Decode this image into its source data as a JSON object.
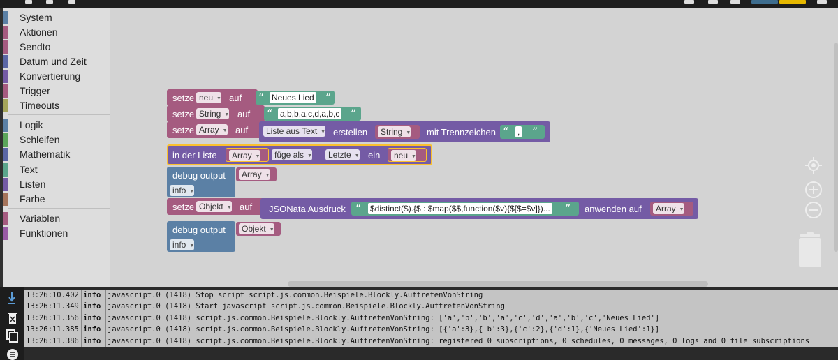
{
  "toolbox": {
    "items": [
      {
        "label": "System",
        "color": "#5b80a5"
      },
      {
        "label": "Aktionen",
        "color": "#a55b80"
      },
      {
        "label": "Sendto",
        "color": "#a55b80"
      },
      {
        "label": "Datum und Zeit",
        "color": "#5b67a5"
      },
      {
        "label": "Konvertierung",
        "color": "#745ba5"
      },
      {
        "label": "Trigger",
        "color": "#a55b80"
      },
      {
        "label": "Timeouts",
        "color": "#a5a55b"
      },
      {
        "label": "Logik",
        "color": "#5b80a5"
      },
      {
        "label": "Schleifen",
        "color": "#5ba55b"
      },
      {
        "label": "Mathematik",
        "color": "#5b67a5"
      },
      {
        "label": "Text",
        "color": "#5ba58c"
      },
      {
        "label": "Listen",
        "color": "#745ba5"
      },
      {
        "label": "Farbe",
        "color": "#a5745b"
      },
      {
        "label": "Variablen",
        "color": "#a55b80"
      },
      {
        "label": "Funktionen",
        "color": "#995ba5"
      }
    ]
  },
  "blocks": {
    "b1": {
      "setze": "setze",
      "var": "neu",
      "auf": "auf",
      "text": "Neues Lied"
    },
    "b2": {
      "setze": "setze",
      "var": "String",
      "auf": "auf",
      "text": "a,b,b,a,c,d,a,b,c"
    },
    "b3": {
      "setze": "setze",
      "var": "Array",
      "auf": "auf",
      "func": "Liste aus Text",
      "erstellen": "erstellen",
      "input": "String",
      "mit": "mit Trennzeichen",
      "sep": ","
    },
    "b4": {
      "inder": "in der Liste",
      "list": "Array",
      "mode": "füge als",
      "where": "Letzte",
      "ein": "ein",
      "item": "neu"
    },
    "b5": {
      "label": "debug output",
      "var": "Array",
      "level": "info"
    },
    "b6": {
      "setze": "setze",
      "var": "Objekt",
      "auf": "auf",
      "func": "JSONata Ausdruck",
      "expr": "$distinct($).{$ : $map($$,function($v){$[$=$v]})...",
      "anwenden": "anwenden auf",
      "input": "Array"
    },
    "b7": {
      "label": "debug output",
      "var": "Objekt",
      "level": "info"
    }
  },
  "log": {
    "rows": [
      {
        "time": "13:26:10.402",
        "level": "info",
        "msg": "javascript.0 (1418) Stop script script.js.common.Beispiele.Blockly.AuftretenVonString"
      },
      {
        "time": "13:26:11.349",
        "level": "info",
        "msg": "javascript.0 (1418) Start javascript script.js.common.Beispiele.Blockly.AuftretenVonString"
      },
      {
        "time": "13:26:11.356",
        "level": "info",
        "msg": "javascript.0 (1418) script.js.common.Beispiele.Blockly.AuftretenVonString: ['a','b','b','a','c','d','a','b','c','Neues Lied']"
      },
      {
        "time": "13:26:11.385",
        "level": "info",
        "msg": "javascript.0 (1418) script.js.common.Beispiele.Blockly.AuftretenVonString: [{'a':3},{'b':3},{'c':2},{'d':1},{'Neues Lied':1}]"
      },
      {
        "time": "13:26:11.386",
        "level": "info",
        "msg": "javascript.0 (1418) script.js.common.Beispiele.Blockly.AuftretenVonString: registered 0 subscriptions, 0 schedules, 0 messages, 0 logs and 0 file subscriptions"
      }
    ]
  },
  "colors": {
    "variables": "#a55b80",
    "lists": "#745ba5",
    "text": "#5ba58c",
    "system": "#5b80a5",
    "selected": "#fbc02d"
  },
  "icons": [
    "arrow-down-icon",
    "delete-log-icon",
    "copy-icon",
    "list-icon",
    "target-icon",
    "zoom-in-icon",
    "zoom-out-icon",
    "trash-icon"
  ]
}
